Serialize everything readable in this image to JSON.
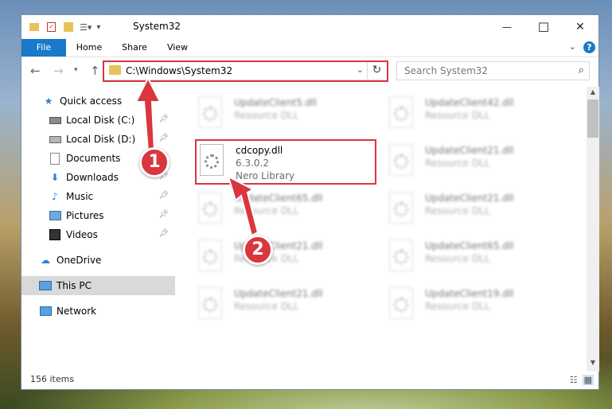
{
  "window": {
    "title": "System32",
    "controls": {
      "minimize": "—",
      "maximize": "☐",
      "close": "✕"
    }
  },
  "ribbon": {
    "tabs": [
      {
        "label": "File"
      },
      {
        "label": "Home"
      },
      {
        "label": "Share"
      },
      {
        "label": "View"
      }
    ],
    "help": "?"
  },
  "address": {
    "path": "C:\\Windows\\System32",
    "search_placeholder": "Search System32"
  },
  "nav": {
    "items": [
      {
        "label": "Quick access",
        "icon": "star-icon"
      },
      {
        "label": "Local Disk (C:)",
        "icon": "drive-icon"
      },
      {
        "label": "Local Disk (D:)",
        "icon": "drive-icon"
      },
      {
        "label": "Documents",
        "icon": "documents-icon"
      },
      {
        "label": "Downloads",
        "icon": "download-icon"
      },
      {
        "label": "Music",
        "icon": "music-icon"
      },
      {
        "label": "Pictures",
        "icon": "pictures-icon"
      },
      {
        "label": "Videos",
        "icon": "videos-icon"
      },
      {
        "label": "OneDrive",
        "icon": "cloud-icon"
      },
      {
        "label": "This PC",
        "icon": "computer-icon"
      },
      {
        "label": "Network",
        "icon": "network-icon"
      }
    ]
  },
  "files": [
    {
      "name": "UpdateClient5.dll",
      "line1": "Resource DLL",
      "line2": ""
    },
    {
      "name": "UpdateClient42.dll",
      "line1": "Resource DLL",
      "line2": ""
    },
    {
      "name": "cdcopy.dll",
      "line1": "6.3.0.2",
      "line2": "Nero Library"
    },
    {
      "name": "UpdateClient21.dll",
      "line1": "Resource DLL",
      "line2": ""
    },
    {
      "name": "UpdateClient65.dll",
      "line1": "Resource DLL",
      "line2": ""
    },
    {
      "name": "UpdateClient21.dll",
      "line1": "Resource DLL",
      "line2": ""
    },
    {
      "name": "UpdateClient21.dll",
      "line1": "Resource DLL",
      "line2": ""
    },
    {
      "name": "UpdateClient65.dll",
      "line1": "Resource DLL",
      "line2": ""
    },
    {
      "name": "UpdateClient21.dll",
      "line1": "Resource DLL",
      "line2": ""
    },
    {
      "name": "UpdateClient19.dll",
      "line1": "Resource DLL",
      "line2": ""
    }
  ],
  "status": {
    "count": "156 items"
  },
  "callouts": [
    {
      "label": "1"
    },
    {
      "label": "2"
    }
  ],
  "colors": {
    "accent": "#1979ca",
    "highlight": "#d9363e",
    "folder": "#e8c25a"
  }
}
